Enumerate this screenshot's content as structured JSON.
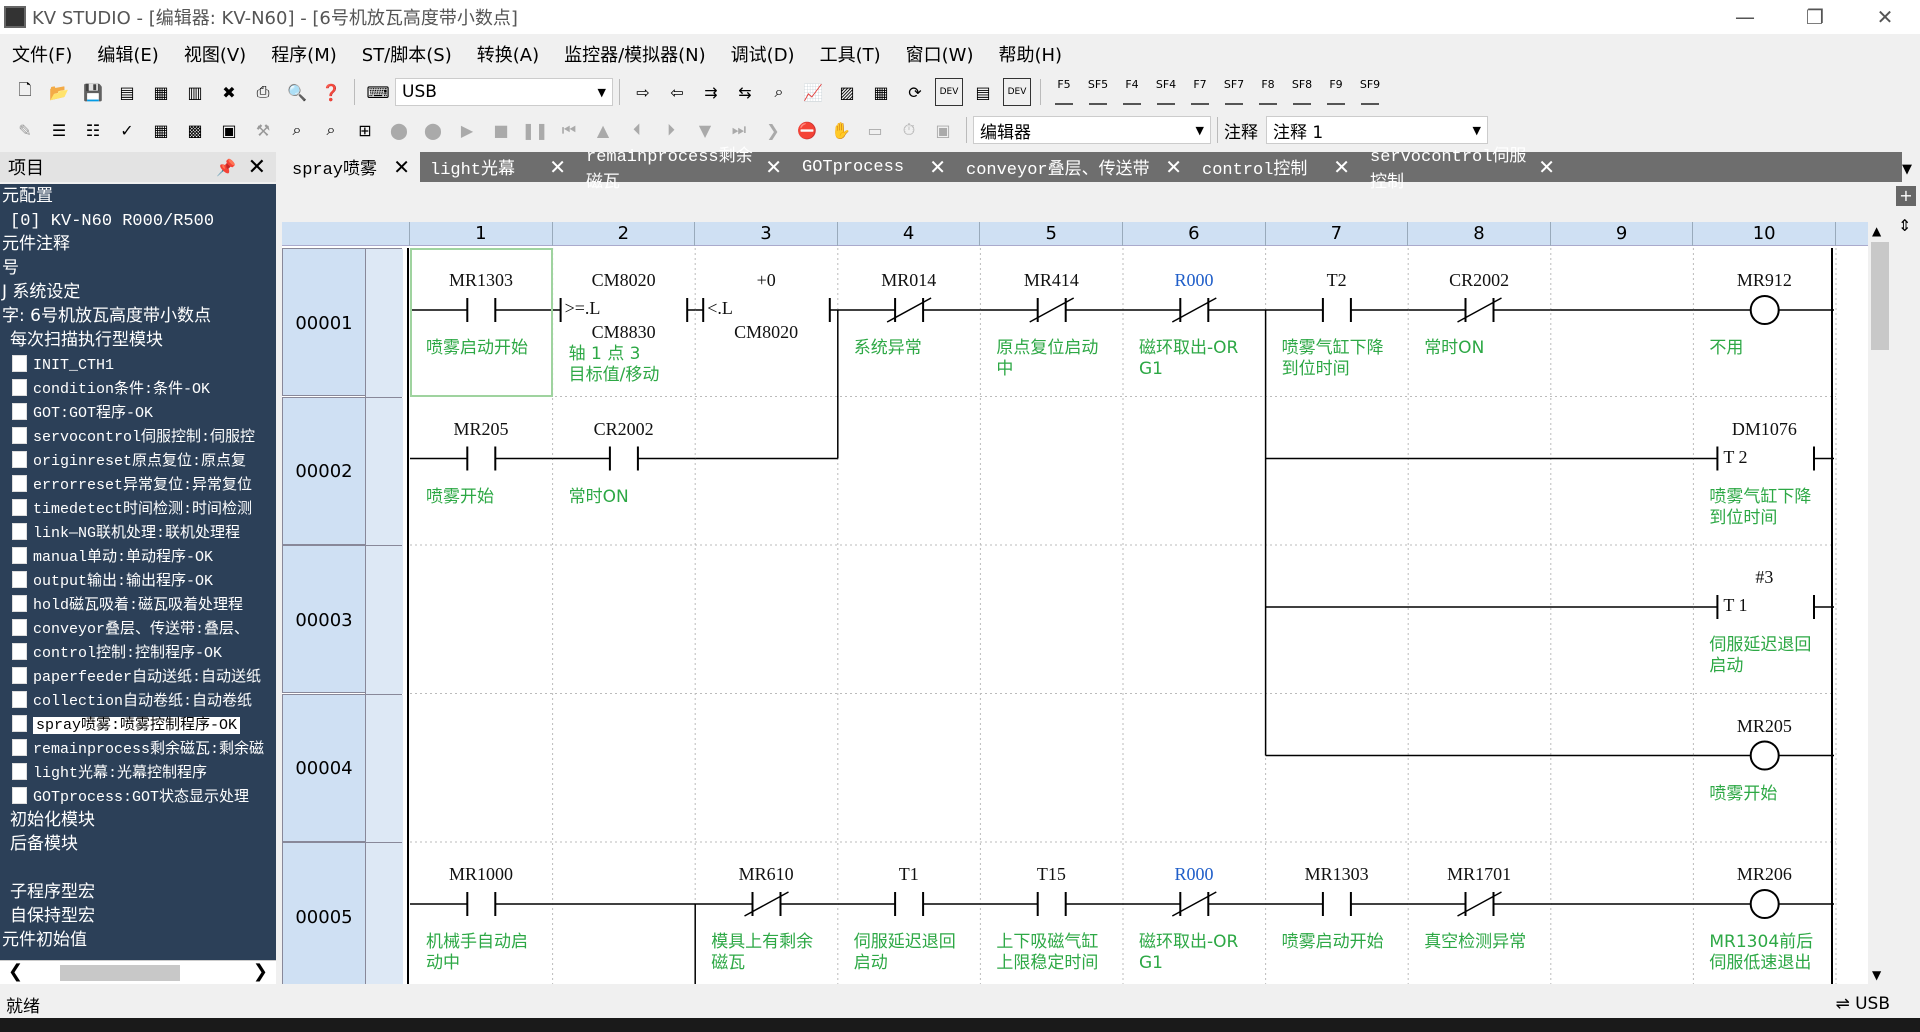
{
  "window": {
    "title": "KV STUDIO - [编辑器: KV-N60] - [6号机放瓦高度带小数点]",
    "minimize": "—",
    "restore": "❐",
    "close": "✕"
  },
  "menu": [
    "文件(F)",
    "编辑(E)",
    "视图(V)",
    "程序(M)",
    "ST/脚本(S)",
    "转换(A)",
    "监控器/模拟器(N)",
    "调试(D)",
    "工具(T)",
    "窗口(W)",
    "帮助(H)"
  ],
  "toolbar": {
    "connection": "USB",
    "mode": "编辑器",
    "comment_label": "注释",
    "comment_value": "注释 1",
    "fkeys": [
      "F5",
      "SF5",
      "F4",
      "SF4",
      "F7",
      "SF7",
      "F8",
      "SF8",
      "F9",
      "SF9"
    ]
  },
  "project_panel": {
    "title": "项目",
    "items": [
      {
        "text": "元配置",
        "indent": 0
      },
      {
        "text": "[0]  KV-N60      R000/R500",
        "indent": 1,
        "mono": true
      },
      {
        "text": "元件注释",
        "indent": 0
      },
      {
        "text": "号",
        "indent": 0
      },
      {
        "text": "J 系统设定",
        "indent": 0
      },
      {
        "text": "字: 6号机放瓦高度带小数点",
        "indent": 0
      },
      {
        "text": "每次扫描执行型模块",
        "indent": 1
      },
      {
        "text": "INIT_CTH1",
        "doc": true
      },
      {
        "text": "condition条件:条件-OK",
        "doc": true
      },
      {
        "text": "GOT:GOT程序-OK",
        "doc": true
      },
      {
        "text": "servocontrol伺服控制:伺服控",
        "doc": true
      },
      {
        "text": "originreset原点复位:原点复",
        "doc": true
      },
      {
        "text": "errorreset异常复位:异常复位",
        "doc": true
      },
      {
        "text": "timedetect时间检测:时间检测",
        "doc": true
      },
      {
        "text": "link—NG联机处理:联机处理程",
        "doc": true
      },
      {
        "text": "manual单动:单动程序-OK",
        "doc": true
      },
      {
        "text": "output输出:输出程序-OK",
        "doc": true
      },
      {
        "text": "hold磁瓦吸着:磁瓦吸着处理程",
        "doc": true
      },
      {
        "text": "conveyor叠层、传送带:叠层、",
        "doc": true
      },
      {
        "text": "control控制:控制程序-OK",
        "doc": true
      },
      {
        "text": "paperfeeder自动送纸:自动送纸",
        "doc": true
      },
      {
        "text": "collection自动卷纸:自动卷纸",
        "doc": true
      },
      {
        "text": "spray喷雾:喷雾控制程序-OK",
        "doc": true,
        "selected": true
      },
      {
        "text": "remainprocess剩余磁瓦:剩余磁",
        "doc": true
      },
      {
        "text": "light光幕:光幕控制程序",
        "doc": true
      },
      {
        "text": "GOTprocess:GOT状态显示处理",
        "doc": true
      },
      {
        "text": "初始化模块",
        "indent": 1
      },
      {
        "text": "后备模块",
        "indent": 1
      },
      {
        "text": "",
        "indent": 0
      },
      {
        "text": "子程序型宏",
        "indent": 1
      },
      {
        "text": "自保持型宏",
        "indent": 1
      },
      {
        "text": "元件初始值",
        "indent": 0
      }
    ]
  },
  "tabs": [
    {
      "label": "spray喷雾",
      "active": true
    },
    {
      "label": "light光幕"
    },
    {
      "label": "remainprocess剩余磁瓦"
    },
    {
      "label": "GOTprocess"
    },
    {
      "label": "conveyor叠层、传送带"
    },
    {
      "label": "control控制"
    },
    {
      "label": "servocontrol伺服控制"
    }
  ],
  "ladder": {
    "columns": [
      "1",
      "2",
      "3",
      "4",
      "5",
      "6",
      "7",
      "8",
      "9",
      "10"
    ],
    "rungs": [
      "00001",
      "00002",
      "00003",
      "00004",
      "00005"
    ],
    "elements": [
      {
        "row": 0,
        "col": 0,
        "type": "no",
        "dev": "MR1303",
        "com": "喷雾启动开始"
      },
      {
        "row": 0,
        "col": 1,
        "type": "cmp",
        "dev": "CM8020",
        "op": ">=.L",
        "dev2": "CM8830",
        "com": "轴 1 点 3\n目标值/移动"
      },
      {
        "row": 0,
        "col": 2,
        "type": "cmp",
        "dev": "+0",
        "op": "<.L",
        "dev2": "CM8020",
        "com": ""
      },
      {
        "row": 0,
        "col": 3,
        "type": "nc",
        "dev": "MR014",
        "com": "系统异常"
      },
      {
        "row": 0,
        "col": 4,
        "type": "nc",
        "dev": "MR414",
        "com": "原点复位启动\n中"
      },
      {
        "row": 0,
        "col": 5,
        "type": "nc",
        "dev": "R000",
        "com": "磁环取出-OR\nG1",
        "blue": true
      },
      {
        "row": 0,
        "col": 6,
        "type": "no",
        "dev": "T2",
        "com": "喷雾气缸下降\n到位时间"
      },
      {
        "row": 0,
        "col": 7,
        "type": "nc",
        "dev": "CR2002",
        "com": "常时ON"
      },
      {
        "row": 0,
        "col": 9,
        "type": "coil",
        "dev": "MR912",
        "com": "不用"
      },
      {
        "row": 1,
        "col": 0,
        "type": "no",
        "dev": "MR205",
        "com": "喷雾开始"
      },
      {
        "row": 1,
        "col": 1,
        "type": "no",
        "dev": "CR2002",
        "com": "常时ON"
      },
      {
        "row": 1,
        "col": 9,
        "type": "timer",
        "dev": "DM1076",
        "tname": "T 2",
        "com": "喷雾气缸下降\n到位时间"
      },
      {
        "row": 2,
        "col": 9,
        "type": "timer",
        "dev": "#3",
        "tname": "T 1",
        "com": "伺服延迟退回\n启动"
      },
      {
        "row": 3,
        "col": 9,
        "type": "coil",
        "dev": "MR205",
        "com": "喷雾开始"
      },
      {
        "row": 4,
        "col": 0,
        "type": "no",
        "dev": "MR1000",
        "com": "机械手自动启\n动中"
      },
      {
        "row": 4,
        "col": 2,
        "type": "nc",
        "dev": "MR610",
        "com": "模具上有剩余\n磁瓦"
      },
      {
        "row": 4,
        "col": 3,
        "type": "no",
        "dev": "T1",
        "com": "伺服延迟退回\n启动"
      },
      {
        "row": 4,
        "col": 4,
        "type": "no",
        "dev": "T15",
        "com": "上下吸磁气缸\n上限稳定时间"
      },
      {
        "row": 4,
        "col": 5,
        "type": "nc",
        "dev": "R000",
        "com": "磁环取出-OR\nG1",
        "blue": true
      },
      {
        "row": 4,
        "col": 6,
        "type": "no",
        "dev": "MR1303",
        "com": "喷雾启动开始"
      },
      {
        "row": 4,
        "col": 7,
        "type": "nc",
        "dev": "MR1701",
        "com": "真空检测异常"
      },
      {
        "row": 4,
        "col": 9,
        "type": "coil",
        "dev": "MR206",
        "com": "MR1304前后\n伺服低速退出"
      }
    ]
  },
  "status": {
    "text": "就绪",
    "conn": "USB"
  },
  "colors": {
    "tree_bg": "#2c4058",
    "comment_green": "#2da845",
    "blue_device": "#1f5ec9",
    "header_blue": "#cfe0f3"
  }
}
